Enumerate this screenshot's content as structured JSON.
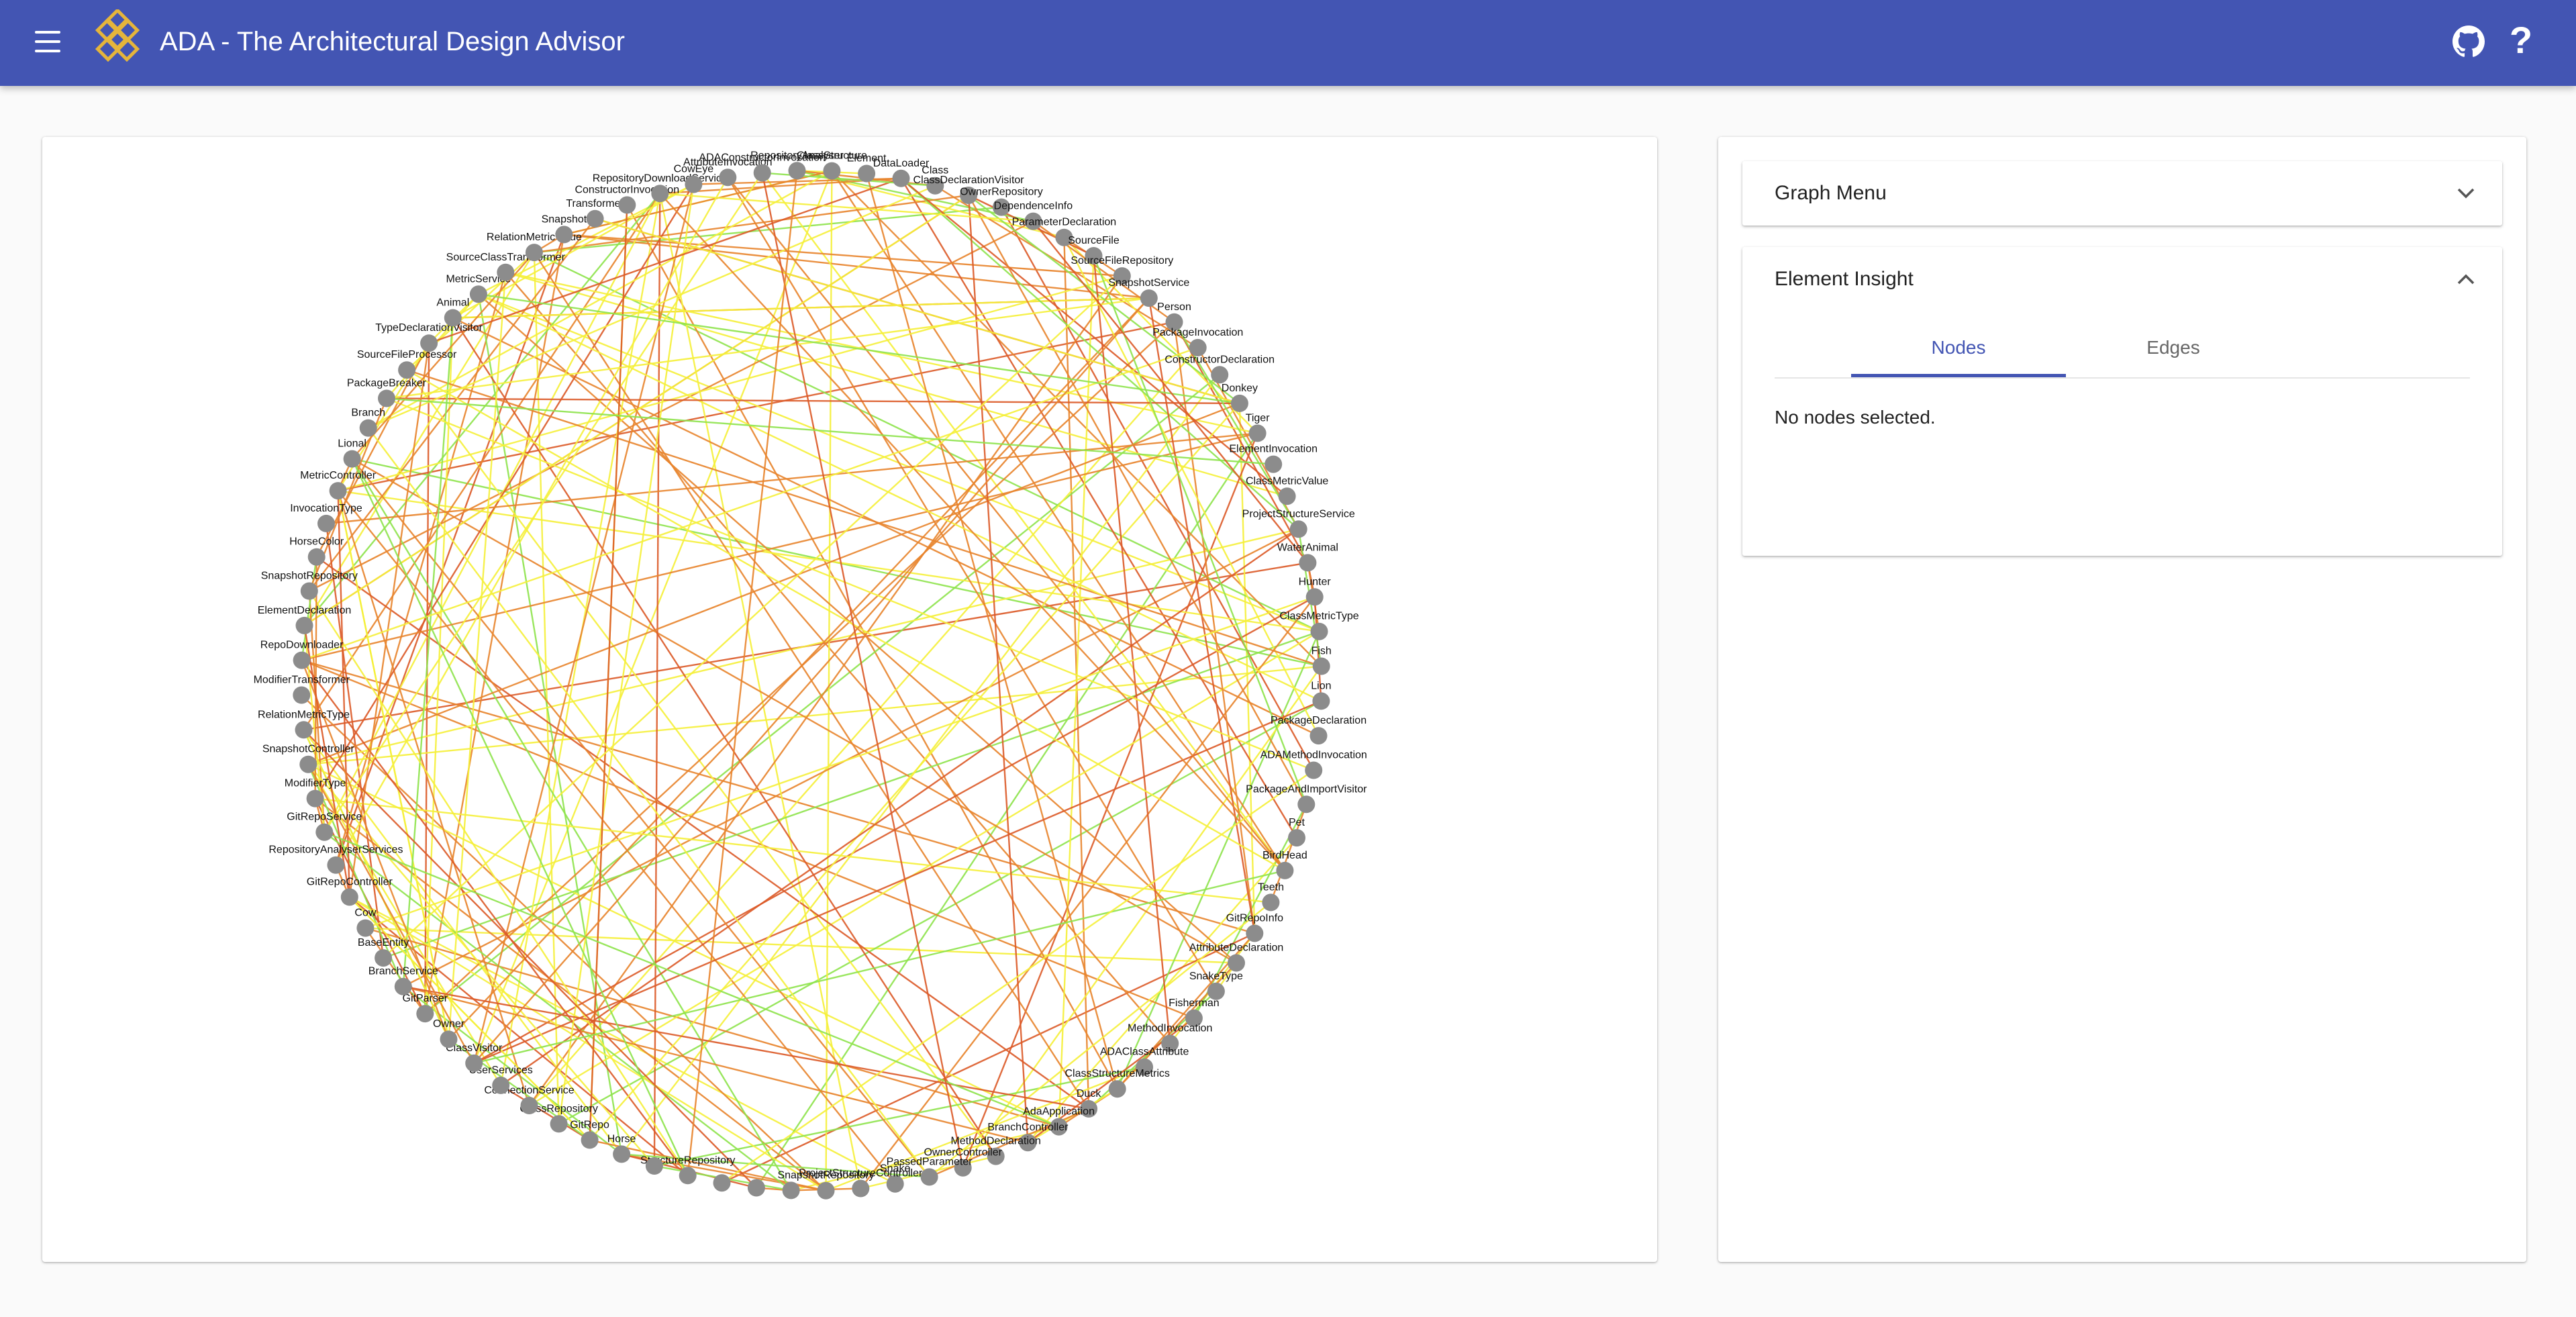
{
  "appbar": {
    "title": "ADA - The Architectural Design Advisor",
    "menu_icon": "menu-icon",
    "logo_icon": "logo-icon",
    "github_icon": "github-icon",
    "help_icon": "help-icon",
    "help_glyph": "?"
  },
  "colors": {
    "primary": "#4355b3",
    "node": "#8c8c8c",
    "edge_orange": "#e8842c",
    "edge_yellow": "#f5ef3a",
    "edge_green": "#8ee34c",
    "edge_red": "#dc5a28"
  },
  "sidebar": {
    "graph_menu": {
      "title": "Graph Menu",
      "expanded": false
    },
    "element_insight": {
      "title": "Element Insight",
      "expanded": true,
      "tabs": [
        {
          "label": "Nodes",
          "active": true
        },
        {
          "label": "Edges",
          "active": false
        }
      ],
      "empty_message": "No nodes selected."
    }
  },
  "graph": {
    "nodes": [
      "ClassStructure",
      "Element",
      "DataLoader",
      "Class",
      "ClassDeclarationVisitor",
      "OwnerRepository",
      "DependenceInfo",
      "ParameterDeclaration",
      "SourceFile",
      "SourceFileRepository",
      "SnapshotService",
      "Person",
      "PackageInvocation",
      "ConstructorDeclaration",
      "Donkey",
      "Tiger",
      "ElementInvocation",
      "ClassMetricValue",
      "ProjectStructureService",
      "WaterAnimal",
      "Hunter",
      "ClassMetricType",
      "Fish",
      "Lion",
      "PackageDeclaration",
      "ADAMethodInvocation",
      "PackageAndImportVisitor",
      "Pet",
      "BirdHead",
      "Teeth",
      "GitRepoInfo",
      "AttributeDeclaration",
      "SnakeType",
      "Fisherman",
      "MethodInvocation",
      "ADAClassAttribute",
      "ClassStructureMetrics",
      "Duck",
      "AdaApplication",
      "BranchController",
      "MethodDeclaration",
      "OwnerController",
      "PassedParameter",
      "Snake",
      "ProjectStructureController",
      "SnapshotRepository",
      "",
      "",
      "",
      "StructureRepository",
      "",
      "Horse",
      "GitRepo",
      "ClassRepository",
      "ConnectionService",
      "UserServices",
      "ClassVisitor",
      "Owner",
      "GitParser",
      "BranchService",
      "BaseEntity",
      "Cow",
      "GitRepoController",
      "RepositoryAnalyserServices",
      "GitRepoService",
      "ModifierType",
      "SnapshotController",
      "RelationMetricType",
      "ModifierTransformer",
      "RepoDownloader",
      "ElementDeclaration",
      "SnapshotRepository",
      "HorseColor",
      "InvocationType",
      "MetricController",
      "Lional",
      "Branch",
      "PackageBreaker",
      "SourceFileProcessor",
      "TypeDeclarationVisitor",
      "Animal",
      "MetricService",
      "SourceClassTransformer",
      "RelationMetricValue",
      "Snapshot",
      "Transformer",
      "ConstructorInvocation",
      "RepositoryDownloadService",
      "CowEye",
      "AttributeInvocation",
      "ADAConstructorInvocation",
      "RepositoryAnalyser"
    ]
  }
}
